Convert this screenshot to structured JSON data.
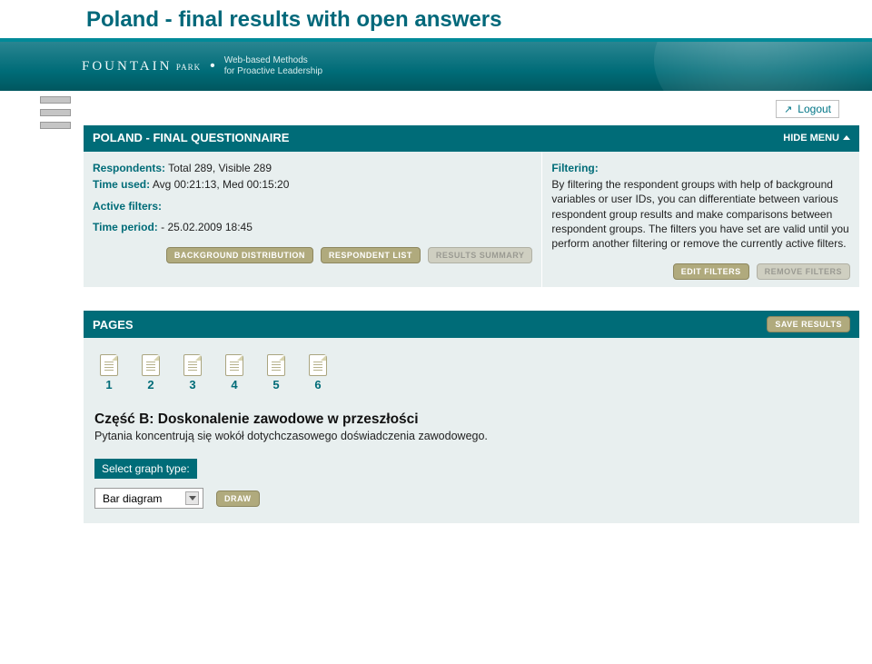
{
  "page_title": "Poland - final results with open answers",
  "brand": {
    "main": "FOUNTAIN",
    "sub": "PARK"
  },
  "tagline": {
    "line1": "Web-based Methods",
    "line2": "for Proactive Leadership"
  },
  "logout": "Logout",
  "questionnaire": {
    "title": "POLAND - FINAL QUESTIONNAIRE",
    "hide_menu": "HIDE MENU",
    "respondents_label": "Respondents:",
    "respondents_value": "Total 289, Visible 289",
    "time_used_label": "Time used:",
    "time_used_value": "Avg 00:21:13, Med 00:15:20",
    "active_filters_label": "Active filters:",
    "time_period_label": "Time period:",
    "time_period_value": " - 25.02.2009 18:45",
    "buttons": {
      "bg_dist": "BACKGROUND DISTRIBUTION",
      "resp_list": "RESPONDENT LIST",
      "res_summary": "RESULTS SUMMARY"
    }
  },
  "filtering": {
    "title": "Filtering:",
    "body": "By filtering the respondent groups with help of background variables or user IDs, you can differentiate between various respondent group results and make comparisons between respondent groups. The filters you have set are valid until you perform another filtering or remove the currently active filters.",
    "edit": "EDIT FILTERS",
    "remove": "REMOVE FILTERS"
  },
  "pages": {
    "title": "PAGES",
    "save": "SAVE RESULTS",
    "items": [
      "1",
      "2",
      "3",
      "4",
      "5",
      "6"
    ],
    "section_title": "Część B: Doskonalenie zawodowe w przeszłości",
    "section_sub": "Pytania koncentrują się wokół dotychczasowego doświadczenia zawodowego.",
    "select_label": "Select graph type:",
    "select_value": "Bar diagram",
    "draw": "DRAW"
  }
}
